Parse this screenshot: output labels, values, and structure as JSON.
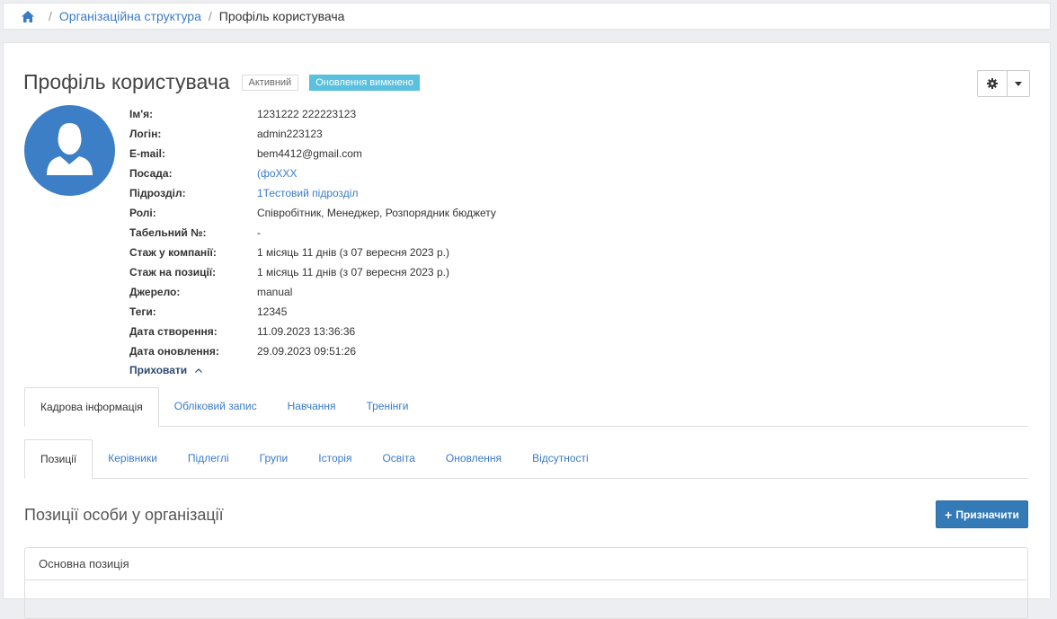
{
  "breadcrumb": {
    "home_icon": "home-icon",
    "separator": "/",
    "items": [
      "Організаційна структура"
    ],
    "current": "Профіль користувача"
  },
  "profile": {
    "title": "Профіль користувача",
    "status_badge": "Активний",
    "updates_badge": "Оновлення вимкнено",
    "badge_color": "#5bc0de",
    "avatar_color": "#3c7fc6"
  },
  "settings": {
    "icon": "gear-icon",
    "caret_icon": "caret-down-icon"
  },
  "info": [
    {
      "label": "Ім'я:",
      "value": "1231222 222223123"
    },
    {
      "label": "Логін:",
      "value": "admin223123"
    },
    {
      "label": "E-mail:",
      "value": "bem4412@gmail.com"
    },
    {
      "label": "Посада:",
      "value": "(фоXXX"
    },
    {
      "label": "Підрозділ:",
      "value": "1Тестовий підрозділ"
    },
    {
      "label": "Ролі:",
      "value": "Співробітник, Менеджер, Розпорядник бюджету"
    },
    {
      "label": "Табельний №:",
      "value": "-"
    },
    {
      "label": "Стаж у компанії:",
      "value": "1 місяць 11 днів (з 07 вересня 2023 р.)"
    },
    {
      "label": "Стаж на позиції:",
      "value": "1 місяць 11 днів (з 07 вересня 2023 р.)"
    },
    {
      "label": "Джерело:",
      "value": "manual"
    },
    {
      "label": "Теги:",
      "value": "12345"
    },
    {
      "label": "Дата створення:",
      "value": "11.09.2023 13:36:36"
    },
    {
      "label": "Дата оновлення:",
      "value": "29.09.2023 09:51:26"
    }
  ],
  "hide_toggle": "Приховати",
  "tabs_main": [
    "Кадрова інформація",
    "Обліковий запис",
    "Навчання",
    "Тренінги"
  ],
  "tabs_sub": [
    "Позиції",
    "Керівники",
    "Підлеглі",
    "Групи",
    "Історія",
    "Освіта",
    "Оновлення",
    "Відсутності"
  ],
  "section": {
    "title": "Позиції особи у організації",
    "assign_button": "Призначити",
    "assign_color": "#337ab7",
    "main_position_header": "Основна позиція"
  }
}
